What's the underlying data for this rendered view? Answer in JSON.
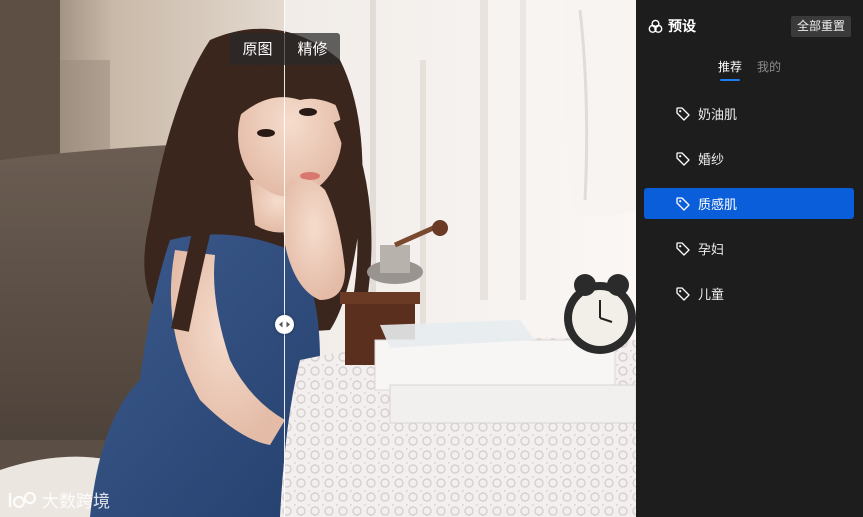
{
  "compare": {
    "left_label": "原图",
    "right_label": "精修"
  },
  "watermark": {
    "text": "大数跨境",
    "icon": "logo-icon"
  },
  "panel": {
    "title": "预设",
    "title_icon": "presets-icon",
    "reset_label": "全部重置",
    "tabs": [
      {
        "label": "推荐",
        "active": true
      },
      {
        "label": "我的",
        "active": false
      }
    ],
    "presets": [
      {
        "label": "奶油肌",
        "icon": "tag-icon",
        "selected": false
      },
      {
        "label": "婚纱",
        "icon": "tag-icon",
        "selected": false
      },
      {
        "label": "质感肌",
        "icon": "tag-icon",
        "selected": true
      },
      {
        "label": "孕妇",
        "icon": "tag-icon",
        "selected": false
      },
      {
        "label": "儿童",
        "icon": "tag-icon",
        "selected": false
      }
    ],
    "accent_color": "#0b5ed9"
  }
}
